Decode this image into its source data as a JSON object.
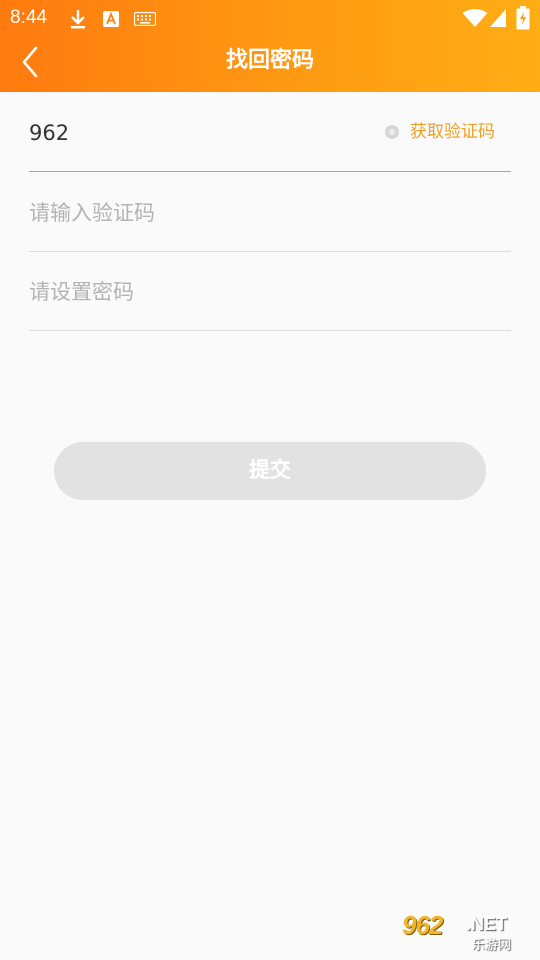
{
  "status_bar": {
    "time": "8:44",
    "icons": [
      "download-icon",
      "a-notification-icon",
      "keyboard-icon",
      "wifi-icon",
      "signal-icon",
      "battery-icon"
    ]
  },
  "nav": {
    "title": "找回密码",
    "back_icon": "chevron-left-icon"
  },
  "form": {
    "phone": {
      "value": "962",
      "get_code_label": "获取验证码"
    },
    "code": {
      "placeholder": "请输入验证码"
    },
    "password": {
      "placeholder": "请设置密码"
    },
    "submit_label": "提交"
  },
  "watermark": {
    "number": "962",
    "suffix": ".NET",
    "subtitle": "乐游网"
  },
  "colors": {
    "header_start": "#ff7a0f",
    "header_end": "#ffad14",
    "accent": "#f0a020",
    "active_underline": "#ff8f2a",
    "button_disabled": "#e2e2e2"
  }
}
